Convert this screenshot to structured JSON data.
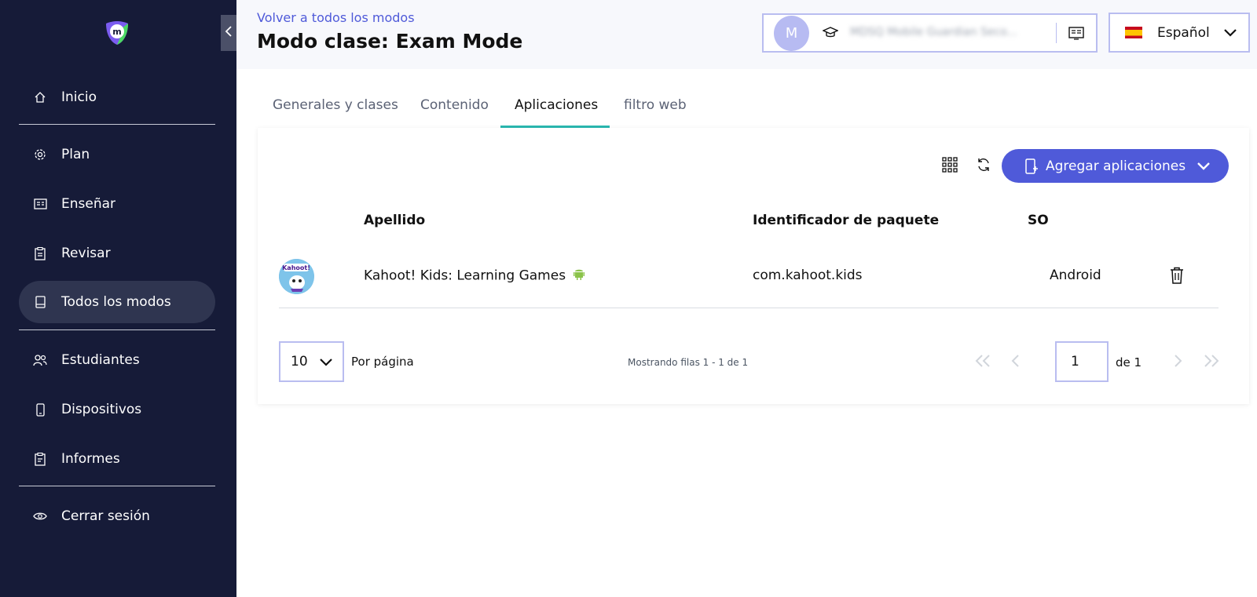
{
  "sidebar": {
    "items": [
      {
        "label": "Inicio",
        "icon": "home-icon"
      },
      {
        "label": "Plan",
        "icon": "gear-icon"
      },
      {
        "label": "Enseñar",
        "icon": "presentation-icon"
      },
      {
        "label": "Revisar",
        "icon": "clipboard-icon"
      },
      {
        "label": "Todos los modos",
        "icon": "book-icon",
        "active": true
      },
      {
        "label": "Estudiantes",
        "icon": "users-icon"
      },
      {
        "label": "Dispositivos",
        "icon": "phone-icon"
      },
      {
        "label": "Informes",
        "icon": "report-icon"
      },
      {
        "label": "Cerrar sesión",
        "icon": "eye-icon"
      }
    ]
  },
  "header": {
    "back_link": "Volver a todos los modos",
    "title": "Modo clase: Exam Mode",
    "user": {
      "avatar_letter": "M",
      "school_name": "MDSQ Mobile Guardian Seco..."
    },
    "language": {
      "label": "Español",
      "flag": "spain-flag-icon"
    }
  },
  "tabs": [
    {
      "label": "Generales y clases"
    },
    {
      "label": "Contenido"
    },
    {
      "label": "Aplicaciones",
      "active": true
    },
    {
      "label": "filtro web"
    }
  ],
  "toolbar": {
    "add_label": "Agregar aplicaciones"
  },
  "table": {
    "headers": [
      "Apellido",
      "Identificador de paquete",
      "SO"
    ],
    "rows": [
      {
        "name": "Kahoot! Kids: Learning Games",
        "package": "com.kahoot.kids",
        "os": "Android"
      }
    ]
  },
  "pagination": {
    "per_page_value": "10",
    "per_page_label": "Por página",
    "showing": "Mostrando filas 1 - 1 de 1",
    "current_page": "1",
    "of_label": "de 1"
  },
  "colors": {
    "sidebar_bg": "#161b38",
    "accent": "#4f5ad9",
    "tab_underline": "#2ab8b0",
    "android_green": "#8bc34a"
  }
}
